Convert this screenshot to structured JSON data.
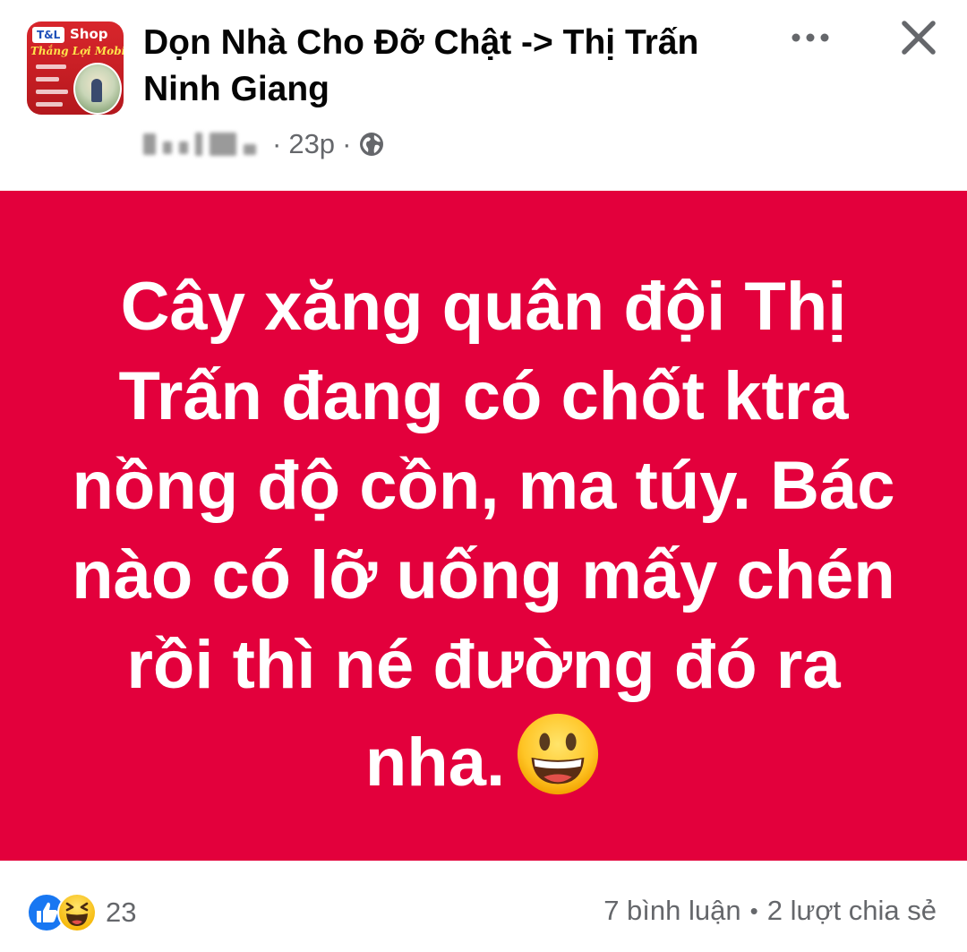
{
  "header": {
    "page_name": "Dọn Nhà Cho Đỡ Chật -> Thị Trấn Ninh Giang",
    "time_ago": "23p",
    "separator": "·",
    "avatar": {
      "logo_text": "T&L",
      "shop_text": "Shop",
      "brand_text": "Thắng Lợi Mobile"
    }
  },
  "post": {
    "background_color": "#e3003c",
    "text": "Cây xăng quân đội Thị Trấn đang có chốt ktra nồng độ cồn, ma túy. Bác nào có lỡ uống mấy chén rồi thì né đường đó ra nha.",
    "emoji": "grinning-face"
  },
  "footer": {
    "reaction_types": [
      "like",
      "haha"
    ],
    "reaction_count": "23",
    "comments": "7 bình luận",
    "bullet": "•",
    "shares": "2 lượt chia sẻ"
  },
  "colors": {
    "brand_blue": "#1877f2",
    "text_primary": "#050505",
    "text_secondary": "#65676b",
    "post_background": "#e3003c"
  },
  "icons": [
    "more-icon",
    "close-icon",
    "globe-icon",
    "like-icon",
    "haha-icon",
    "grinning-face-emoji"
  ]
}
